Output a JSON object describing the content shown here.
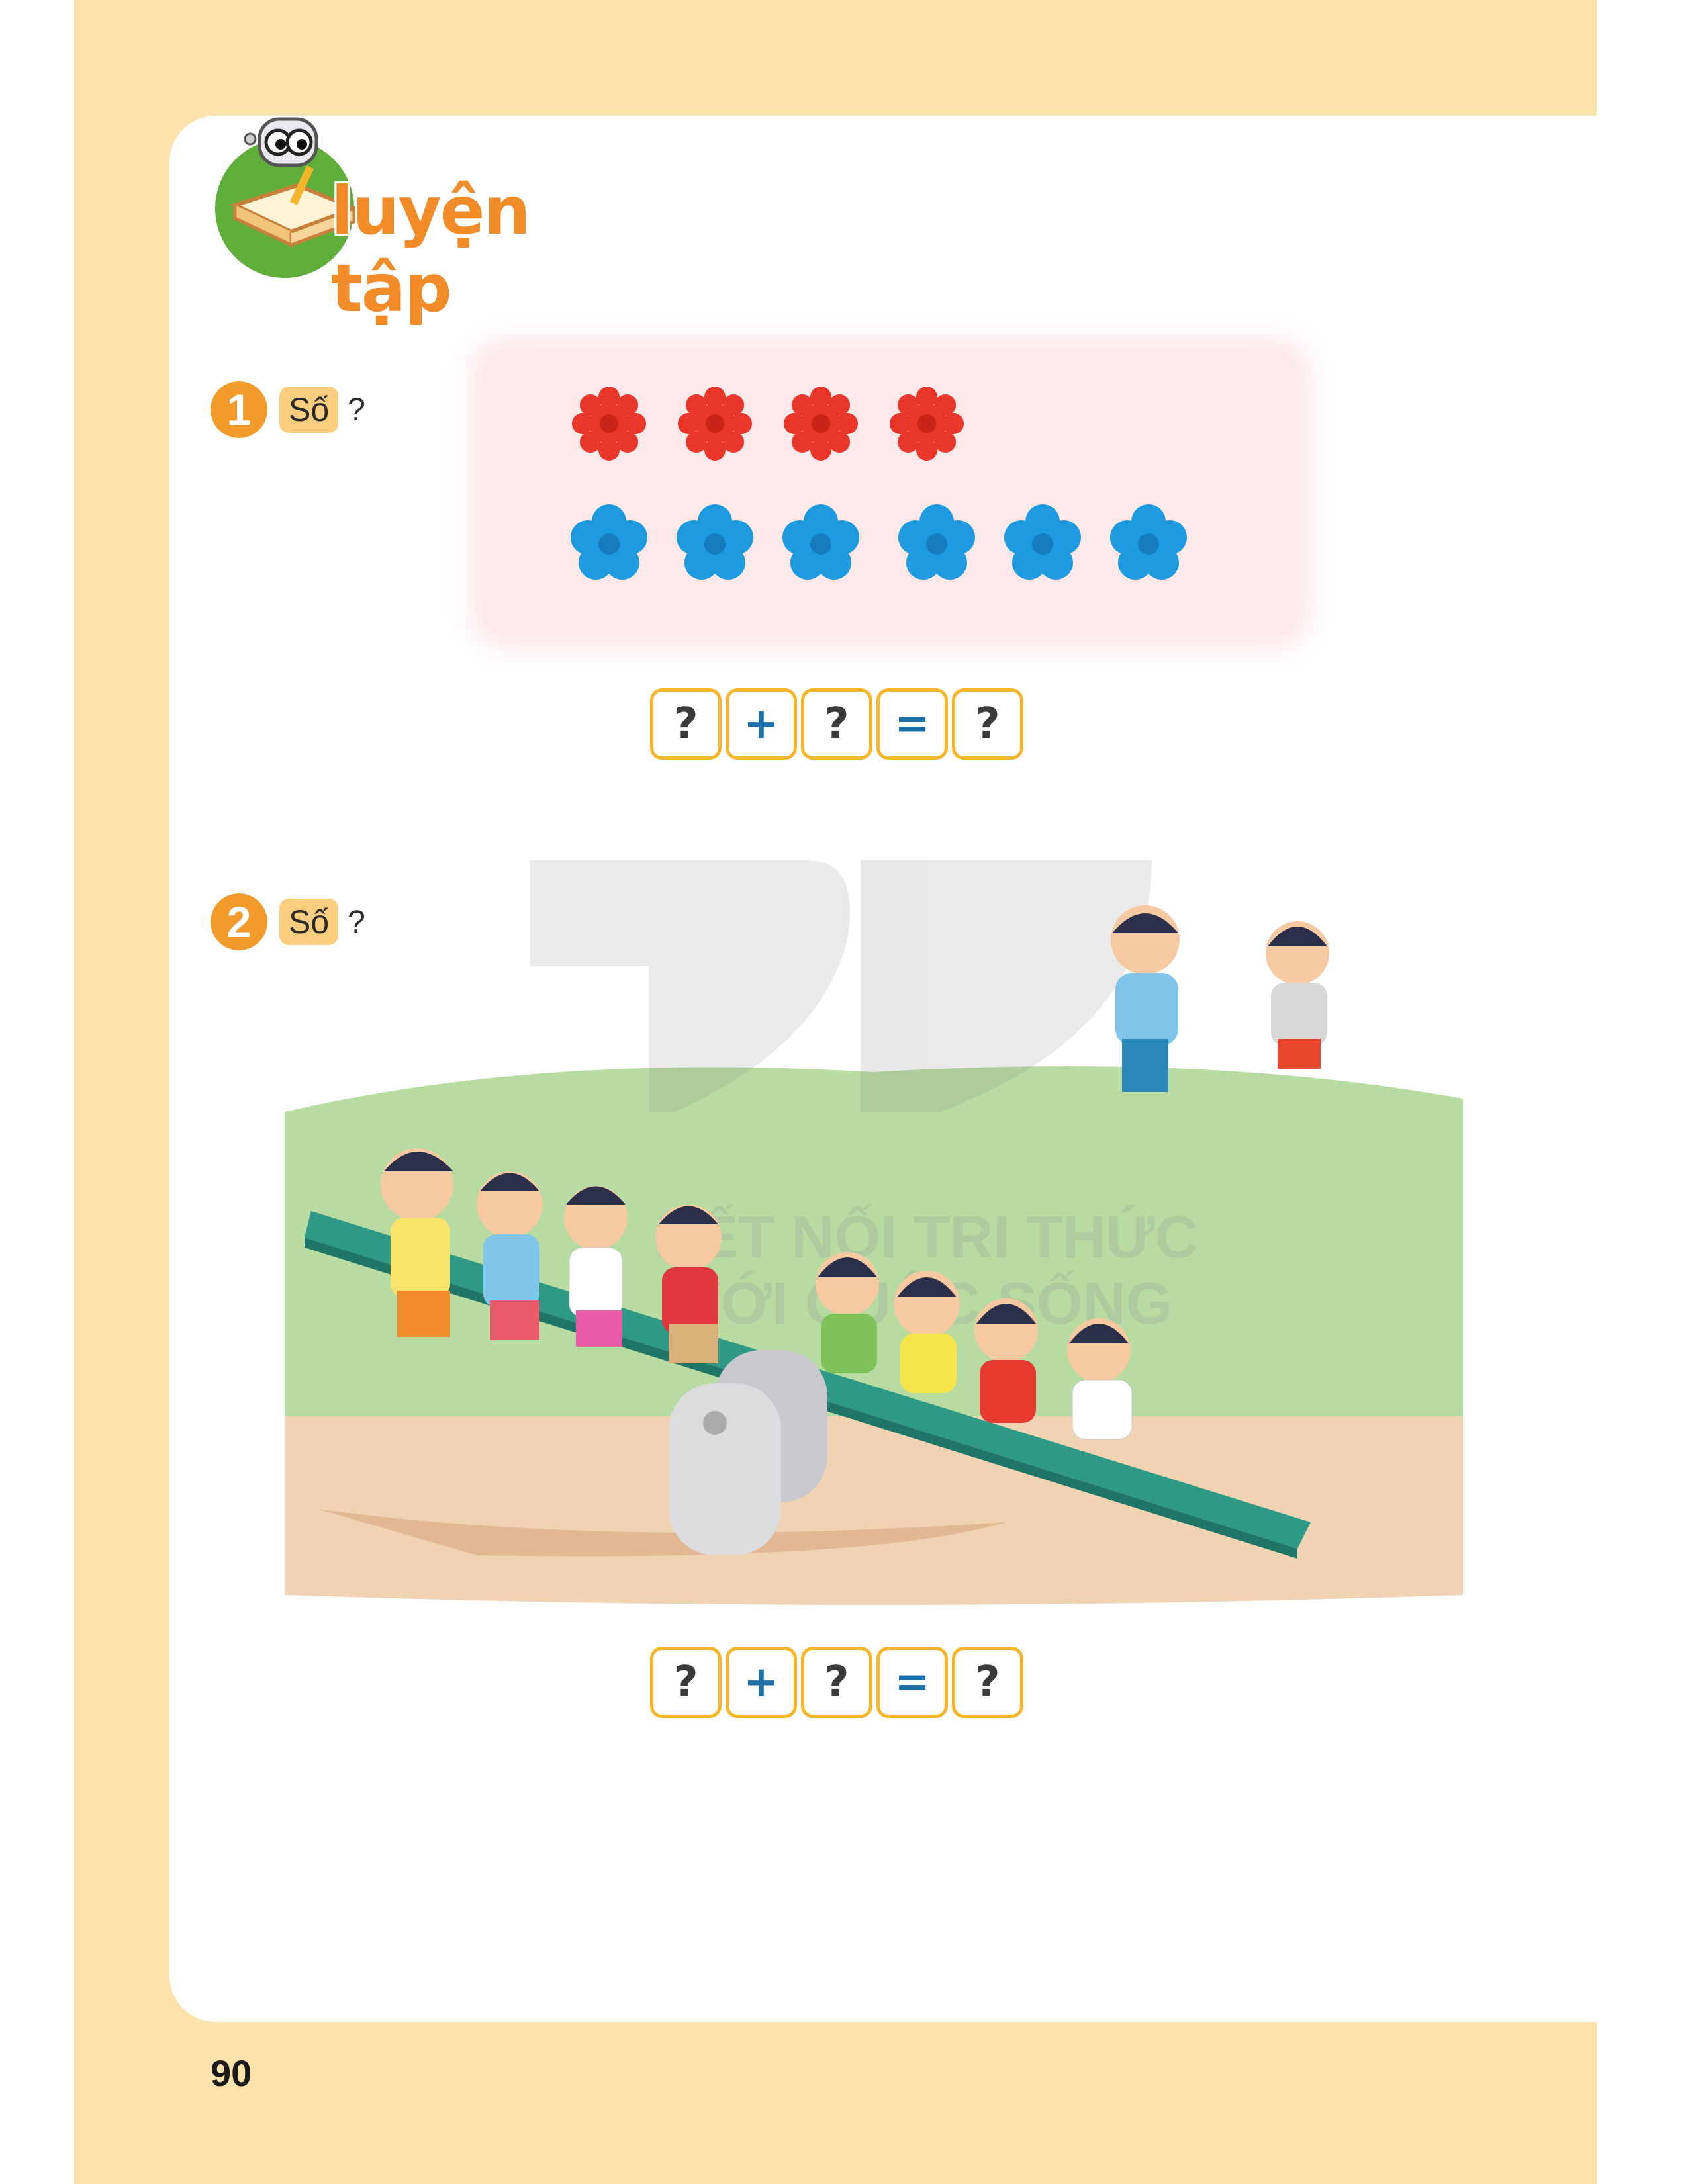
{
  "header": {
    "title": "luyện tập"
  },
  "exercises": [
    {
      "number": "1",
      "label": "Số",
      "question_mark": "?",
      "equation": [
        "?",
        "+",
        "?",
        "=",
        "?"
      ]
    },
    {
      "number": "2",
      "label": "Số",
      "question_mark": "?",
      "equation": [
        "?",
        "+",
        "?",
        "=",
        "?"
      ]
    }
  ],
  "flowers": {
    "red_count": 4,
    "blue_count": 6,
    "red_color": "#e8372a",
    "blue_color": "#1e9be0"
  },
  "watermark": {
    "line1": "KẾT NỐI TRI THỨC",
    "line2": "VỚI CUỘC SỐNG"
  },
  "page_number": "90"
}
